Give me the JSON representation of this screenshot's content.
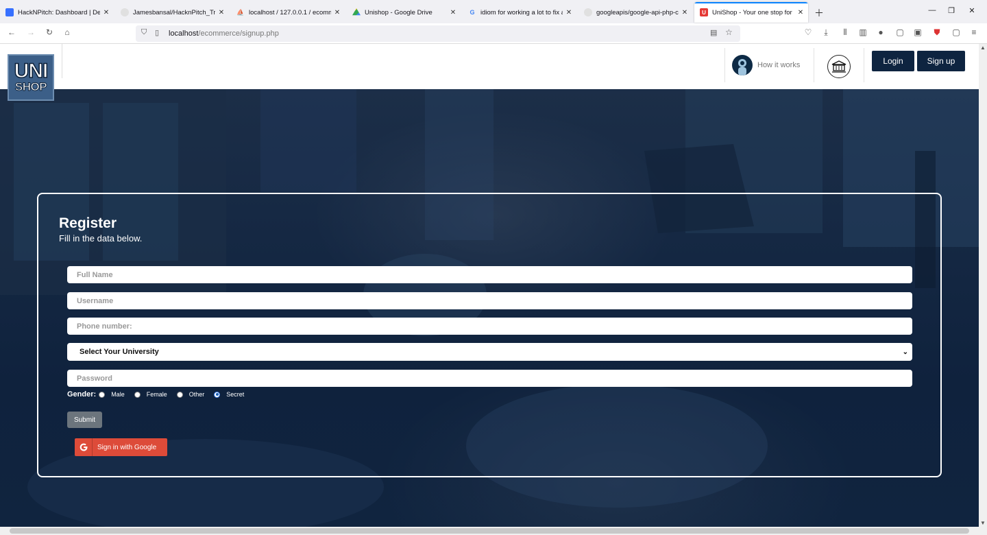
{
  "browser": {
    "tabs": [
      {
        "title": "HackNPitch: Dashboard | Devfo",
        "icon": "devfolio-icon"
      },
      {
        "title": "Jamesbansal/HacknPitch_Trojan",
        "icon": "github-icon"
      },
      {
        "title": "localhost / 127.0.0.1 / ecommerce",
        "icon": "phpmyadmin-icon"
      },
      {
        "title": "Unishop - Google Drive",
        "icon": "google-drive-icon"
      },
      {
        "title": "idiom for working a lot to fix a",
        "icon": "google-icon"
      },
      {
        "title": "googleapis/google-api-php-cli",
        "icon": "github-icon"
      },
      {
        "title": "UniShop - Your one stop for bu",
        "icon": "unishop-icon"
      }
    ],
    "active_tab": 6,
    "url_host": "localhost",
    "url_path": "/ecommerce/signup.php"
  },
  "header": {
    "logo_line1": "UNI",
    "logo_line2": "SHOP",
    "how_it_works": "How it works",
    "login_label": "Login",
    "signup_label": "Sign up"
  },
  "form": {
    "title": "Register",
    "subtitle": "Fill in the data below.",
    "fullname_placeholder": "Full Name",
    "username_placeholder": "Username",
    "phone_placeholder": "Phone number:",
    "university_selected": "Select Your University",
    "password_placeholder": "Password",
    "gender_label": "Gender:",
    "gender_options": [
      "Male",
      "Female",
      "Other",
      "Secret"
    ],
    "gender_selected": "Secret",
    "submit_label": "Submit",
    "google_label": "Sign in with Google"
  },
  "colors": {
    "navy": "#0e2440",
    "google_red": "#dd4b39",
    "submit_gray": "#6c757d"
  }
}
